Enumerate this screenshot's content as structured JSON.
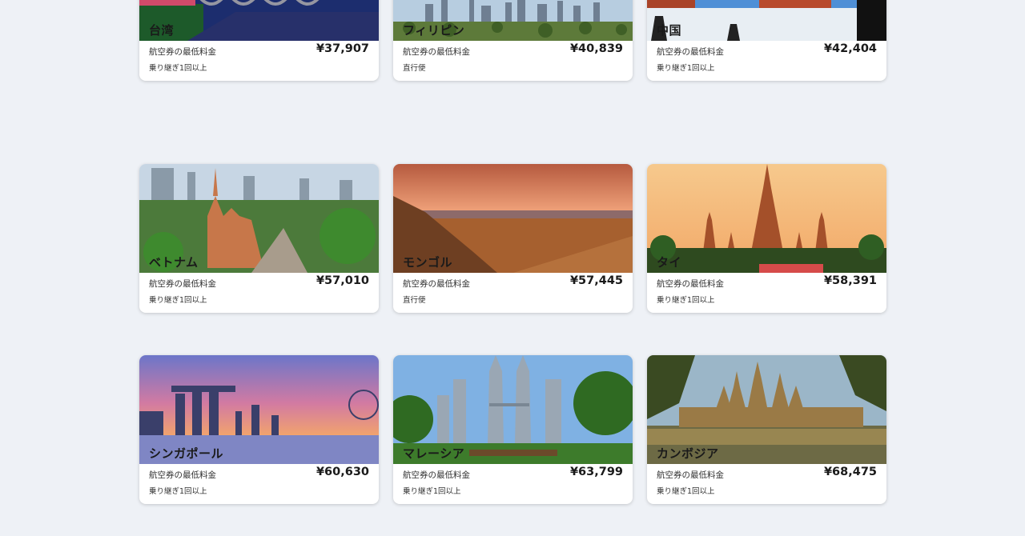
{
  "cards": [
    {
      "name": "台湾",
      "label": "航空券の最低料金",
      "price": "¥37,907",
      "note": "乗り継ぎ1回以上"
    },
    {
      "name": "フィリピン",
      "label": "航空券の最低料金",
      "price": "¥40,839",
      "note": "直行便"
    },
    {
      "name": "中国",
      "label": "航空券の最低料金",
      "price": "¥42,404",
      "note": "乗り継ぎ1回以上"
    },
    {
      "name": "ベトナム",
      "label": "航空券の最低料金",
      "price": "¥57,010",
      "note": "乗り継ぎ1回以上"
    },
    {
      "name": "モンゴル",
      "label": "航空券の最低料金",
      "price": "¥57,445",
      "note": "直行便"
    },
    {
      "name": "タイ",
      "label": "航空券の最低料金",
      "price": "¥58,391",
      "note": "乗り継ぎ1回以上"
    },
    {
      "name": "シンガポール",
      "label": "航空券の最低料金",
      "price": "¥60,630",
      "note": "乗り継ぎ1回以上"
    },
    {
      "name": "マレーシア",
      "label": "航空券の最低料金",
      "price": "¥63,799",
      "note": "乗り継ぎ1回以上"
    },
    {
      "name": "カンボジア",
      "label": "航空券の最低料金",
      "price": "¥68,475",
      "note": "乗り継ぎ1回以上"
    }
  ]
}
